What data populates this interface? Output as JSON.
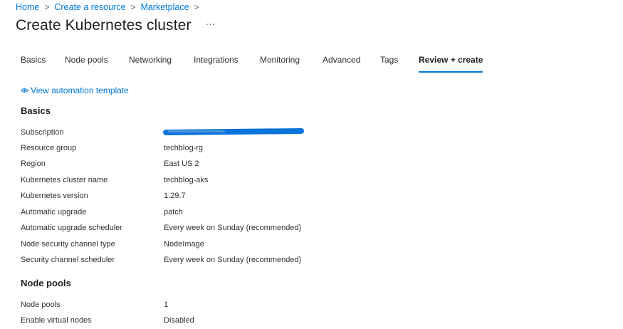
{
  "breadcrumb": {
    "items": [
      "Home",
      "Create a resource",
      "Marketplace"
    ]
  },
  "page": {
    "title": "Create Kubernetes cluster",
    "more": "···"
  },
  "tabs": [
    "Basics",
    "Node pools",
    "Networking",
    "Integrations",
    "Monitoring",
    "Advanced",
    "Tags",
    "Review + create"
  ],
  "active_tab": "Review + create",
  "automation_link": "View automation template",
  "colors": {
    "accent": "#0078d4",
    "redaction": "#0a74da"
  },
  "basics": {
    "title": "Basics",
    "rows": [
      {
        "label": "Subscription",
        "value": ""
      },
      {
        "label": "Resource group",
        "value": "techblog-rg"
      },
      {
        "label": "Region",
        "value": "East US 2"
      },
      {
        "label": "Kubernetes cluster name",
        "value": "techblog-aks"
      },
      {
        "label": "Kubernetes version",
        "value": "1.29.7"
      },
      {
        "label": "Automatic upgrade",
        "value": "patch"
      },
      {
        "label": "Automatic upgrade scheduler",
        "value": "Every week on Sunday (recommended)"
      },
      {
        "label": "Node security channel type",
        "value": "NodeImage"
      },
      {
        "label": "Security channel scheduler",
        "value": "Every week on Sunday (recommended)"
      }
    ]
  },
  "node_pools": {
    "title": "Node pools",
    "rows": [
      {
        "label": "Node pools",
        "value": "1"
      },
      {
        "label": "Enable virtual nodes",
        "value": "Disabled"
      }
    ]
  }
}
